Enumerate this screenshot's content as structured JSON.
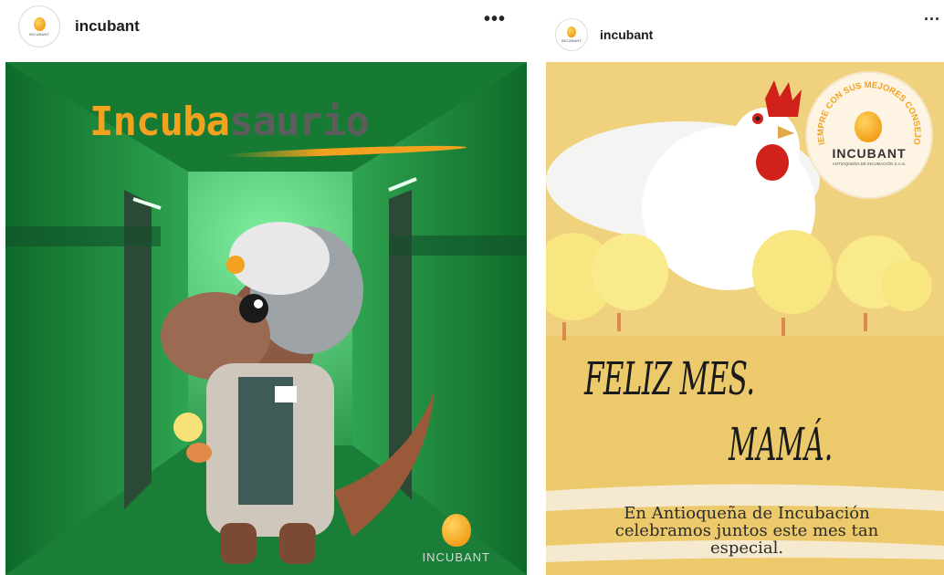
{
  "posts": [
    {
      "username": "incubant",
      "more_label": "•••",
      "avatar_text": "INCUBANT",
      "image": {
        "title_part1": "Incuba",
        "title_part2": "saurio",
        "logo_text": "INCUBANT",
        "accent": "#f2a21e",
        "background": "#1f8a3c"
      }
    },
    {
      "username": "incubant",
      "more_label": "...",
      "avatar_text": "INCUBANT",
      "image": {
        "seal_arc_text": "SIEMPRE CON SUS MEJORES CONSEJOS",
        "seal_brand": "INCUBANT",
        "seal_sub": "ANTIOQUEÑA DE INCUBACIÓN S.A.S.",
        "greeting_line1": "FELIZ MES.",
        "greeting_line2": "MAMÁ.",
        "message": "En Antioqueña de Incubación celebramos juntos este mes tan especial.",
        "background": "#e9c86a"
      }
    }
  ]
}
